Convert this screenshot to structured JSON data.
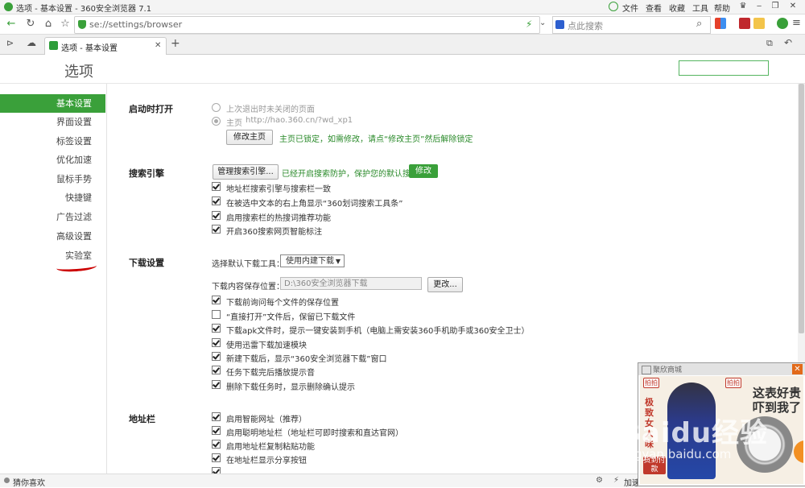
{
  "window": {
    "title": "选项 - 基本设置 - 360安全浏览器 7.1",
    "menu": [
      "文件",
      "查看",
      "收藏",
      "工具",
      "帮助"
    ]
  },
  "navbar": {
    "url": "se://settings/browser",
    "search_placeholder": "点此搜索"
  },
  "tabs": [
    {
      "label": "选项 - 基本设置"
    }
  ],
  "page": {
    "title": "选项"
  },
  "sidebar": {
    "items": [
      {
        "label": "基本设置",
        "active": true
      },
      {
        "label": "界面设置"
      },
      {
        "label": "标签设置"
      },
      {
        "label": "优化加速"
      },
      {
        "label": "鼠标手势"
      },
      {
        "label": "快捷键"
      },
      {
        "label": "广告过滤"
      },
      {
        "label": "高级设置"
      },
      {
        "label": "实验室"
      }
    ]
  },
  "startup": {
    "section": "启动时打开",
    "option_restore": "上次退出时未关闭的页面",
    "option_home_label": "主页",
    "home_url": "http://hao.360.cn/?wd_xp1",
    "modify_home_button": "修改主页",
    "home_locked_msg": "主页已锁定，如需修改，请点“修改主页”然后解除锁定"
  },
  "search_engine": {
    "section": "搜索引擎",
    "manage_button": "管理搜索引擎...",
    "protect_msg": "已经开启搜索防护，保护您的默认搜索",
    "modify_button": "修改",
    "options": [
      {
        "label": "地址栏搜索引擎与搜索栏一致",
        "checked": true
      },
      {
        "label": "在被选中文本的右上角显示“360划词搜索工具条”",
        "checked": true
      },
      {
        "label": "启用搜索栏的热搜词推荐功能",
        "checked": true
      },
      {
        "label": "开启360搜索网页智能标注",
        "checked": true
      }
    ]
  },
  "download": {
    "section": "下载设置",
    "tool_label": "选择默认下载工具：",
    "tool_value": "使用内建下载",
    "path_label": "下载内容保存位置：",
    "path_value": "D:\\360安全浏览器下载",
    "change_button": "更改...",
    "options": [
      {
        "label": "下载前询问每个文件的保存位置",
        "checked": true
      },
      {
        "label": "“直接打开”文件后，保留已下载文件",
        "checked": false
      },
      {
        "label": "下载apk文件时，提示一键安装到手机（电脑上需安装360手机助手或360安全卫士）",
        "checked": true
      },
      {
        "label": "使用迅雷下载加速模块",
        "checked": true
      },
      {
        "label": "新建下载后，显示“360安全浏览器下载”窗口",
        "checked": true
      },
      {
        "label": "任务下载完后播放提示音",
        "checked": true
      },
      {
        "label": "删除下载任务时，显示删除确认提示",
        "checked": true
      }
    ]
  },
  "address_bar": {
    "section": "地址栏",
    "options": [
      {
        "label": "启用智能网址（推荐）",
        "checked": true
      },
      {
        "label": "启用聪明地址栏（地址栏可即时搜索和直达官网）",
        "checked": true
      },
      {
        "label": "启用地址栏复制粘贴功能",
        "checked": true
      },
      {
        "label": "在地址栏显示分享按钮",
        "checked": true
      }
    ]
  },
  "statusbar": {
    "text": "猜你喜欢",
    "right_label": "加速"
  },
  "ad": {
    "brand": "聚欣商城",
    "headline1": "这表好贵",
    "headline2": "吓到我了",
    "tag1": "拍拍",
    "tag2": "拍拍",
    "side_text": "极致女人味",
    "pay_text": "货到付款"
  },
  "watermark": {
    "main": "Baidu经验",
    "sub": "jingyan.baidu.com"
  },
  "colors": {
    "accent": "#3aa03a",
    "sidebar_active": "#3aa03a",
    "annotation": "#cc0000"
  }
}
